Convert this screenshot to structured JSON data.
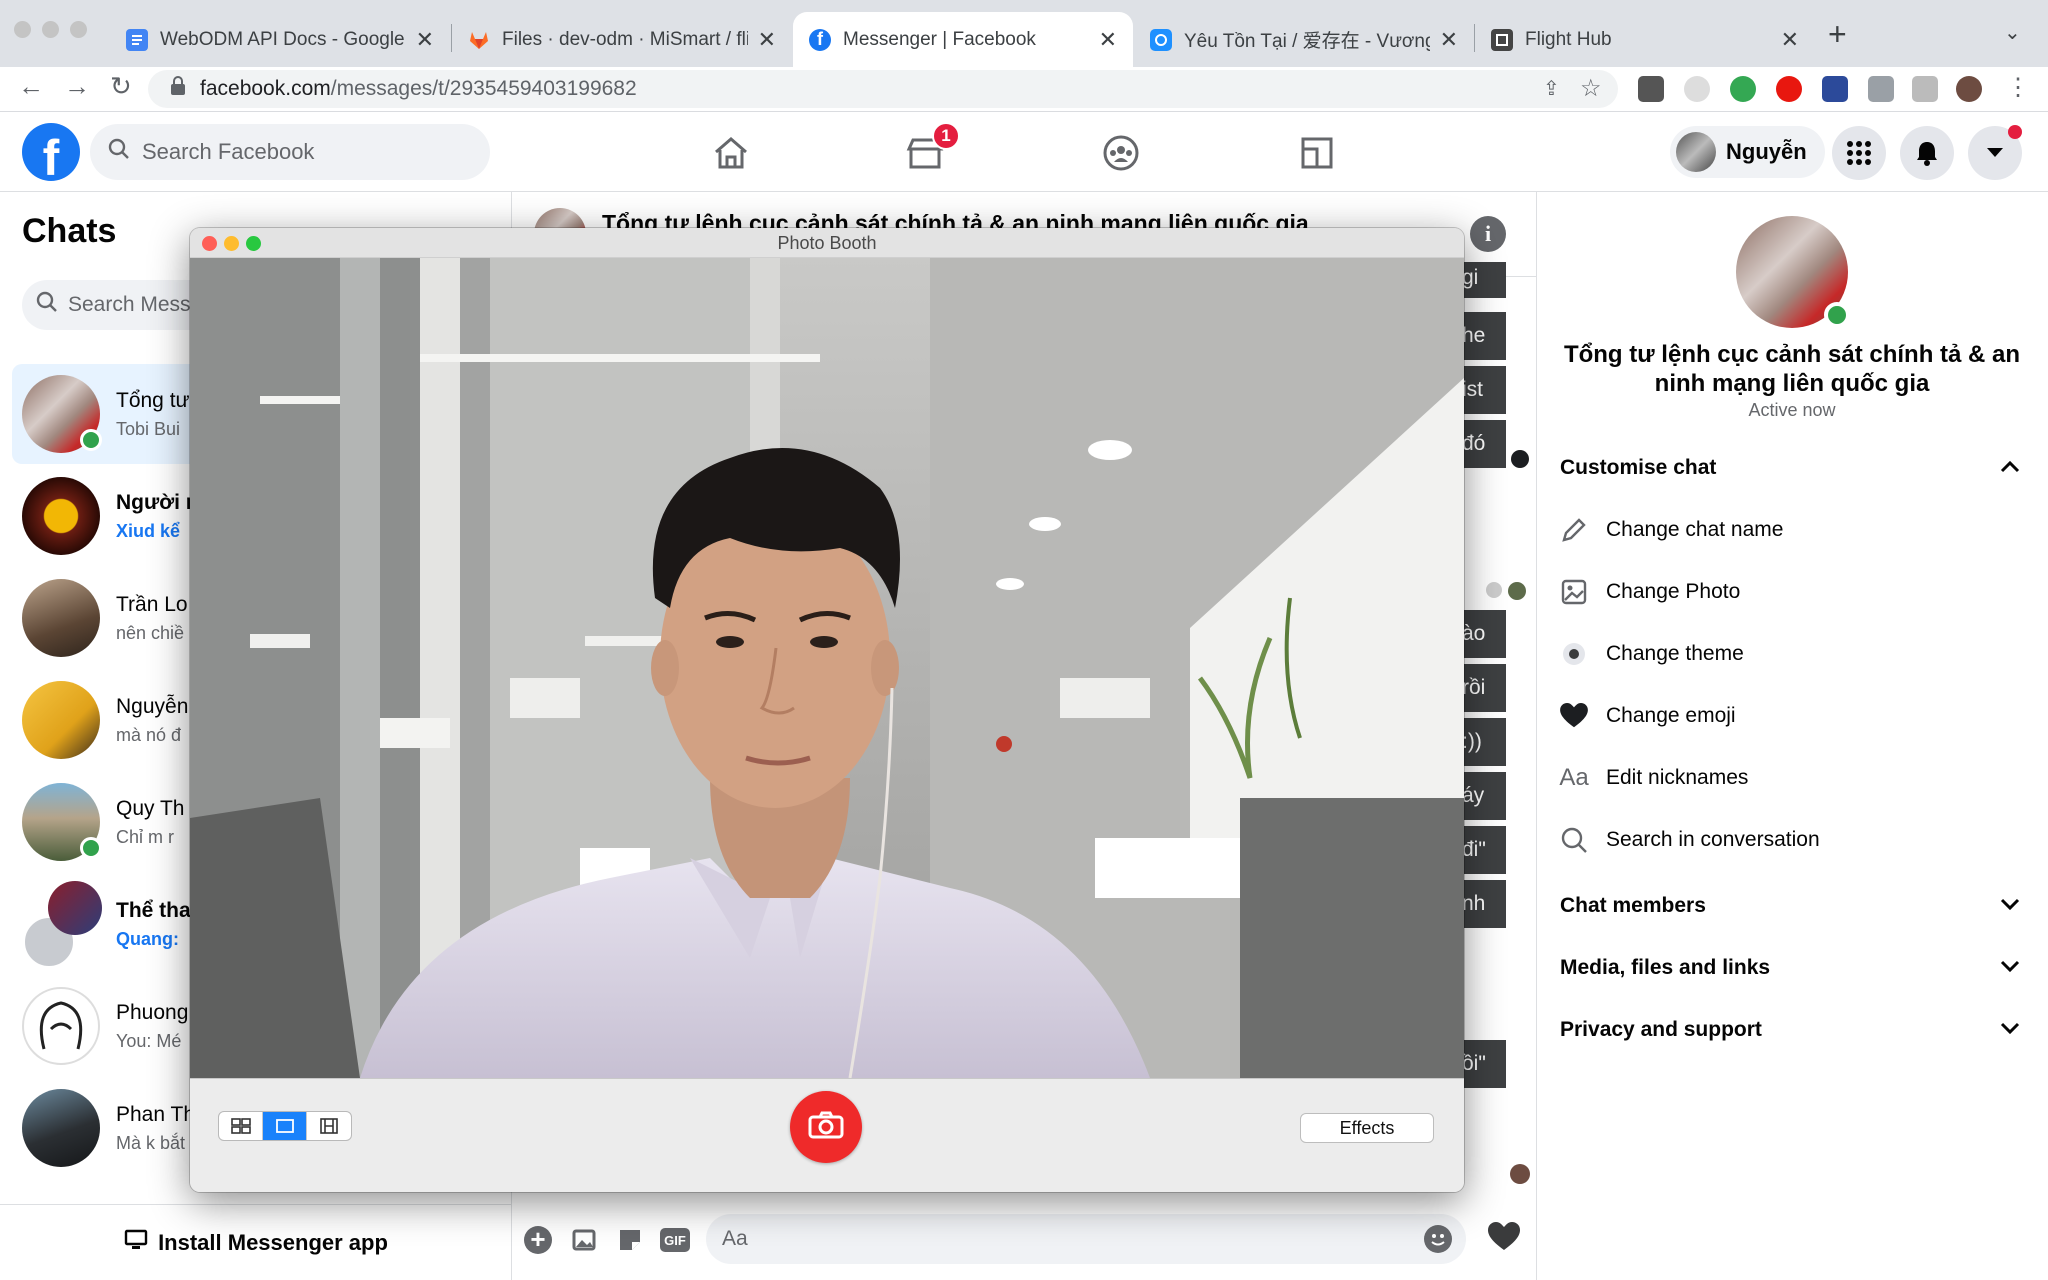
{
  "browser": {
    "tabs": [
      {
        "label": "WebODM API Docs - Google Tài",
        "active": false,
        "icon": "docs-icon"
      },
      {
        "label": "Files · dev-odm · MiSmart / flig",
        "active": false,
        "icon": "gitlab-icon"
      },
      {
        "label": "Messenger | Facebook",
        "active": true,
        "icon": "messenger-icon"
      },
      {
        "label": "Yêu Tồn Tại / 爱存在 - Vương Tĩ",
        "active": false,
        "icon": "music-icon"
      },
      {
        "label": "Flight Hub",
        "active": false,
        "icon": "flighthub-icon"
      }
    ],
    "url_host": "facebook.com",
    "url_path": "/messages/t/2935459403199682"
  },
  "fb": {
    "search_placeholder": "Search Facebook",
    "marketplace_badge": "1",
    "profile_name": "Nguyễn"
  },
  "chats": {
    "title": "Chats",
    "search_placeholder": "Search Messenger",
    "rows": [
      {
        "name": "Tổng tư",
        "preview": "Tobi Bui",
        "bold": false,
        "online": true,
        "selected": true
      },
      {
        "name": "Người r",
        "preview": "Xiud kể",
        "bold": true,
        "online": false,
        "selected": false
      },
      {
        "name": "Trần Lo",
        "preview": "nên chiề",
        "bold": false,
        "online": false,
        "selected": false
      },
      {
        "name": "Nguyễn",
        "preview": "mà nó đ",
        "bold": false,
        "online": false,
        "selected": false
      },
      {
        "name": "Quy Th",
        "preview": "Chỉ m r",
        "bold": false,
        "online": true,
        "selected": false
      },
      {
        "name": "Thể tha",
        "preview": "Quang:",
        "bold": true,
        "online": false,
        "selected": false
      },
      {
        "name": "Phuong",
        "preview": "You: Mé",
        "bold": false,
        "online": false,
        "selected": false
      },
      {
        "name": "Phan Th",
        "preview": "Mà k bắt",
        "bold": false,
        "online": false,
        "selected": false
      }
    ],
    "install_label": "Install Messenger app"
  },
  "conversation": {
    "title": "Tổng tư lệnh cục cảnh sát chính tả & an ninh mạng liên quốc gia",
    "bubbles": [
      "gi",
      "he",
      "ist",
      "đó",
      "ào",
      "rồi",
      ":))",
      "áy",
      "đi\"",
      "nh",
      "ồi\""
    ],
    "composer_placeholder": "Aa"
  },
  "details": {
    "name": "Tổng tư lệnh cục cảnh sát chính tả & an ninh mạng liên quốc gia",
    "status": "Active now",
    "customise_label": "Customise chat",
    "items": [
      {
        "label": "Change chat name",
        "icon": "pencil-icon"
      },
      {
        "label": "Change Photo",
        "icon": "image-icon"
      },
      {
        "label": "Change theme",
        "icon": "theme-icon"
      },
      {
        "label": "Change emoji",
        "icon": "heart-icon"
      },
      {
        "label": "Edit nicknames",
        "icon": "text-aa-icon"
      },
      {
        "label": "Search in conversation",
        "icon": "search-icon"
      }
    ],
    "sections": [
      "Chat members",
      "Media, files and links",
      "Privacy and support"
    ]
  },
  "photobooth": {
    "title": "Photo Booth",
    "effects_label": "Effects"
  },
  "colors": {
    "fb_blue": "#1877f2",
    "online_green": "#31a24c",
    "shutter_red": "#ef2a2a",
    "selected_chat": "#e7f3ff"
  }
}
